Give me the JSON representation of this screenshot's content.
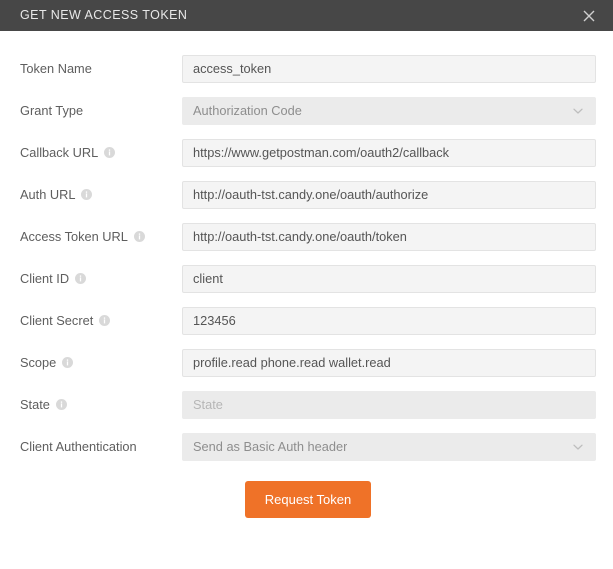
{
  "titlebar": {
    "title": "GET NEW ACCESS TOKEN",
    "close_icon": "close-icon"
  },
  "colors": {
    "titlebar_bg": "#474747",
    "accent_button": "#ef7228",
    "field_bg": "#f4f4f4",
    "field_disabled_bg": "#ebebeb",
    "label_text": "#5e5e5e",
    "value_text": "#555555",
    "placeholder_text": "#b6b6b6"
  },
  "form": {
    "fields": [
      {
        "label": "Token Name",
        "has_info_icon": false,
        "type": "text",
        "value": "access_token",
        "placeholder": "Token Name"
      },
      {
        "label": "Grant Type",
        "has_info_icon": false,
        "type": "select",
        "value": "Authorization Code",
        "placeholder": ""
      },
      {
        "label": "Callback URL",
        "has_info_icon": true,
        "type": "text",
        "value": "https://www.getpostman.com/oauth2/callback",
        "placeholder": "Callback URL"
      },
      {
        "label": "Auth URL",
        "has_info_icon": true,
        "type": "text",
        "value": "http://oauth-tst.candy.one/oauth/authorize",
        "placeholder": "Auth URL"
      },
      {
        "label": "Access Token URL",
        "has_info_icon": true,
        "type": "text",
        "value": "http://oauth-tst.candy.one/oauth/token",
        "placeholder": "Access Token URL"
      },
      {
        "label": "Client ID",
        "has_info_icon": true,
        "type": "text",
        "value": "client",
        "placeholder": "Client ID"
      },
      {
        "label": "Client Secret",
        "has_info_icon": true,
        "type": "text",
        "value": "123456",
        "placeholder": "Client Secret"
      },
      {
        "label": "Scope",
        "has_info_icon": true,
        "type": "text",
        "value": "profile.read phone.read wallet.read",
        "placeholder": "Scope"
      },
      {
        "label": "State",
        "has_info_icon": true,
        "type": "text",
        "value": "",
        "placeholder": "State"
      },
      {
        "label": "Client Authentication",
        "has_info_icon": false,
        "type": "select",
        "value": "Send as Basic Auth header",
        "placeholder": ""
      }
    ],
    "submit_label": "Request Token"
  }
}
